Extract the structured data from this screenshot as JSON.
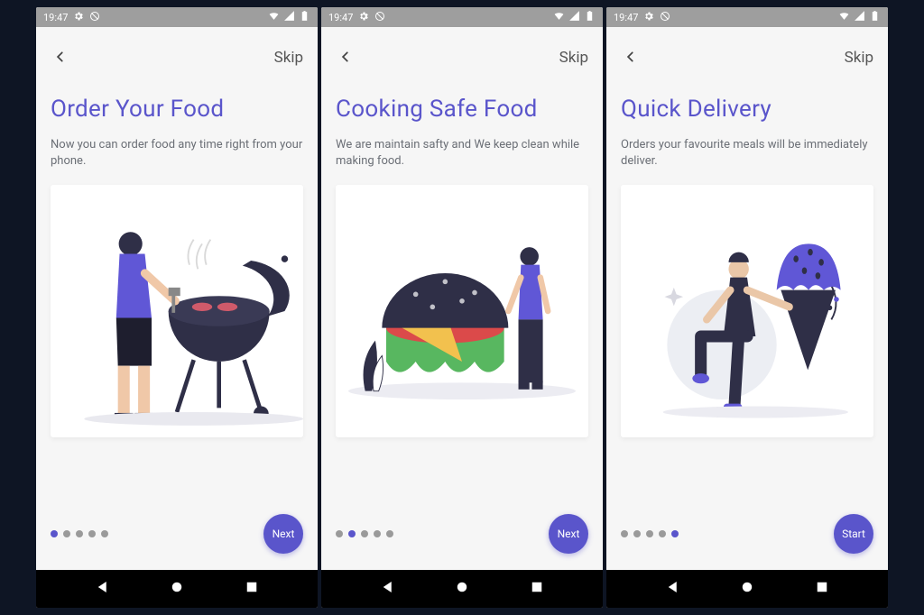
{
  "status": {
    "time": "19:47"
  },
  "screens": [
    {
      "skip": "Skip",
      "title": "Order Your Food",
      "desc": "Now you can order food any time right from your phone.",
      "button": "Next",
      "active_dot": 0,
      "dot_count": 5
    },
    {
      "skip": "Skip",
      "title": "Cooking Safe Food",
      "desc": "We are maintain safty and We keep clean while making food.",
      "button": "Next",
      "active_dot": 1,
      "dot_count": 5
    },
    {
      "skip": "Skip",
      "title": "Quick Delivery",
      "desc": "Orders your favourite meals will be immediately deliver.",
      "button": "Start",
      "active_dot": 4,
      "dot_count": 5
    }
  ]
}
